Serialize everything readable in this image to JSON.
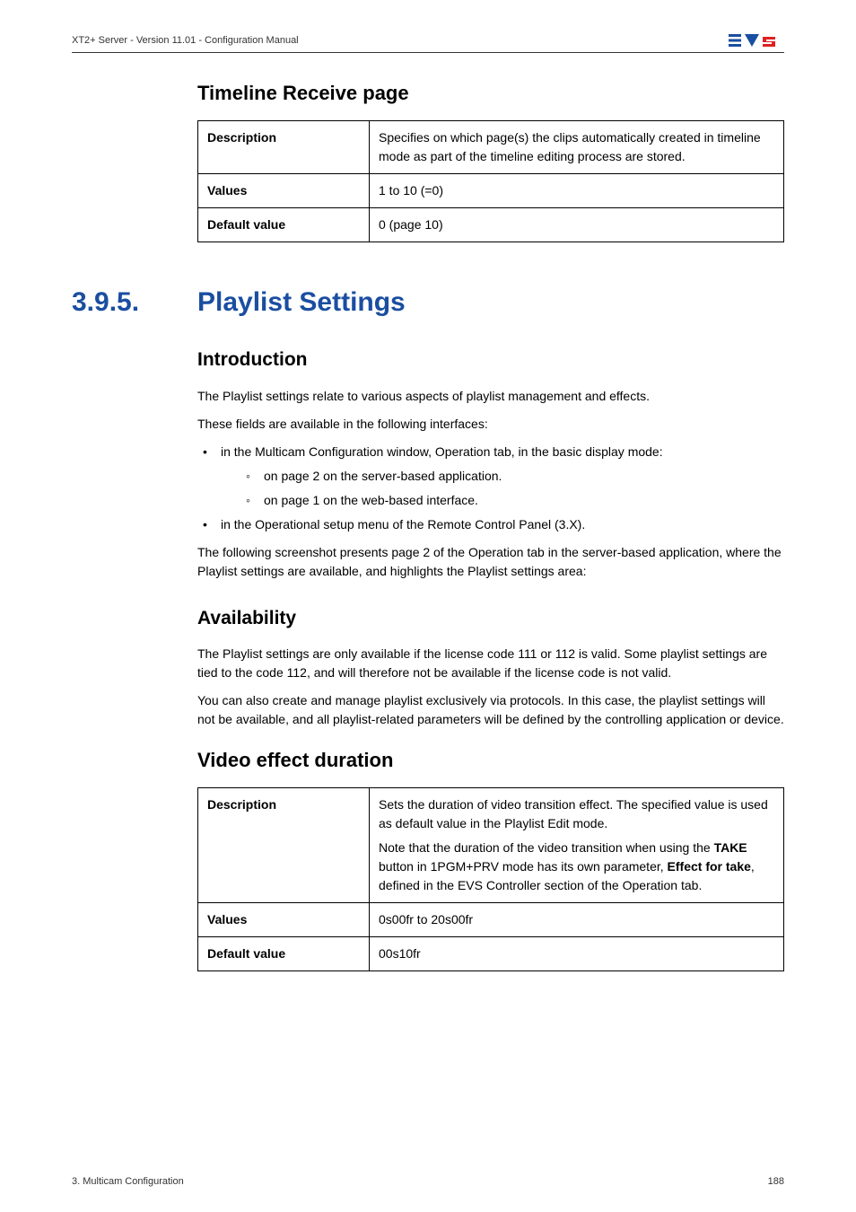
{
  "header": {
    "product": "XT2+ Server - Version 11.01 - Configuration Manual"
  },
  "sections": {
    "timeline_receive": {
      "title": "Timeline Receive page",
      "rows": {
        "desc_label": "Description",
        "desc_value": "Specifies on which page(s) the clips automatically created in timeline mode as part of the timeline editing process are stored.",
        "values_label": "Values",
        "values_value": "1 to 10 (=0)",
        "default_label": "Default value",
        "default_value": "0 (page 10)"
      }
    },
    "playlist": {
      "number": "3.9.5.",
      "title": "Playlist Settings",
      "intro_title": "Introduction",
      "intro_p1": "The Playlist settings relate to various aspects of playlist management and effects.",
      "intro_p2": "These fields are available in the following interfaces:",
      "bullets": {
        "b1": "in the Multicam Configuration window, Operation tab, in the basic display mode:",
        "b1a": "on page 2 on the server-based application.",
        "b1b": "on page 1 on the web-based interface.",
        "b2": "in the Operational setup menu of the Remote Control Panel (3.X)."
      },
      "intro_p3": "The following screenshot presents page 2 of the Operation tab in the server-based application, where the Playlist settings are available, and highlights the Playlist settings area:",
      "avail_title": "Availability",
      "avail_p1": "The Playlist settings are only available if the license code 111 or 112 is valid. Some playlist settings are tied to the code 112, and will therefore not be available if the license code is not valid.",
      "avail_p2": "You can also create and manage playlist exclusively via protocols. In this case, the playlist settings will not be available, and all playlist-related parameters will be defined by the controlling application or device.",
      "video_title": "Video effect duration",
      "video_rows": {
        "desc_label": "Description",
        "desc_v1": "Sets the duration of video transition effect. The specified value is used as default value in the Playlist Edit mode.",
        "desc_v2a": "Note that the duration of the video transition when using the ",
        "desc_v2_take": "TAKE",
        "desc_v2b": " button in 1PGM+PRV mode has its own parameter, ",
        "desc_v2_effect": "Effect for take",
        "desc_v2c": ", defined in the EVS Controller section of the Operation tab.",
        "values_label": "Values",
        "values_value": "0s00fr to 20s00fr",
        "default_label": "Default value",
        "default_value": "00s10fr"
      }
    }
  },
  "footer": {
    "left": "3. Multicam Configuration",
    "right": "188"
  }
}
